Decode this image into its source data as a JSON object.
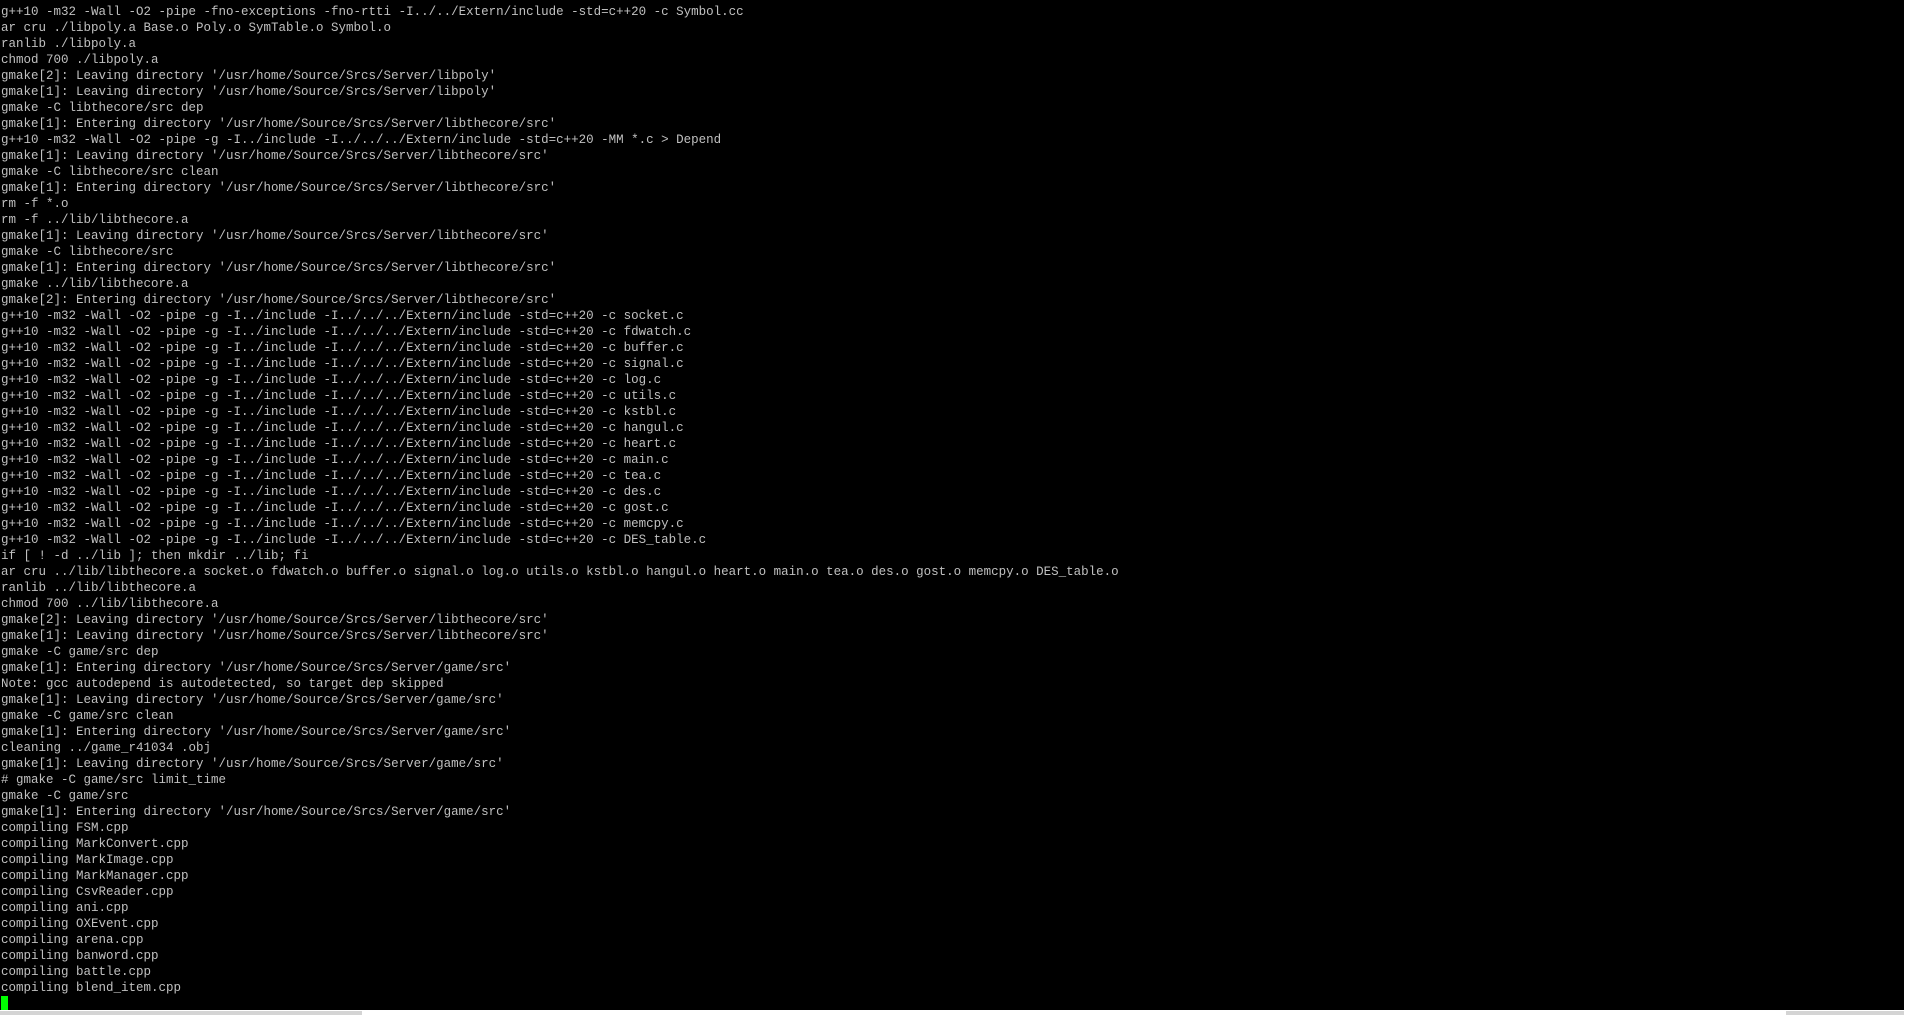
{
  "terminal": {
    "background": "#000000",
    "foreground": "#c0c0c0",
    "cursor_color": "#00ff00",
    "lines": [
      "g++10 -m32 -Wall -O2 -pipe -fno-exceptions -fno-rtti -I../../Extern/include -std=c++20 -c Symbol.cc",
      "ar cru ./libpoly.a Base.o Poly.o SymTable.o Symbol.o",
      "ranlib ./libpoly.a",
      "chmod 700 ./libpoly.a",
      "gmake[2]: Leaving directory '/usr/home/Source/Srcs/Server/libpoly'",
      "gmake[1]: Leaving directory '/usr/home/Source/Srcs/Server/libpoly'",
      "gmake -C libthecore/src dep",
      "gmake[1]: Entering directory '/usr/home/Source/Srcs/Server/libthecore/src'",
      "g++10 -m32 -Wall -O2 -pipe -g -I../include -I../../../Extern/include -std=c++20 -MM *.c > Depend",
      "gmake[1]: Leaving directory '/usr/home/Source/Srcs/Server/libthecore/src'",
      "gmake -C libthecore/src clean",
      "gmake[1]: Entering directory '/usr/home/Source/Srcs/Server/libthecore/src'",
      "rm -f *.o",
      "rm -f ../lib/libthecore.a",
      "gmake[1]: Leaving directory '/usr/home/Source/Srcs/Server/libthecore/src'",
      "gmake -C libthecore/src",
      "gmake[1]: Entering directory '/usr/home/Source/Srcs/Server/libthecore/src'",
      "gmake ../lib/libthecore.a",
      "gmake[2]: Entering directory '/usr/home/Source/Srcs/Server/libthecore/src'",
      "g++10 -m32 -Wall -O2 -pipe -g -I../include -I../../../Extern/include -std=c++20 -c socket.c",
      "g++10 -m32 -Wall -O2 -pipe -g -I../include -I../../../Extern/include -std=c++20 -c fdwatch.c",
      "g++10 -m32 -Wall -O2 -pipe -g -I../include -I../../../Extern/include -std=c++20 -c buffer.c",
      "g++10 -m32 -Wall -O2 -pipe -g -I../include -I../../../Extern/include -std=c++20 -c signal.c",
      "g++10 -m32 -Wall -O2 -pipe -g -I../include -I../../../Extern/include -std=c++20 -c log.c",
      "g++10 -m32 -Wall -O2 -pipe -g -I../include -I../../../Extern/include -std=c++20 -c utils.c",
      "g++10 -m32 -Wall -O2 -pipe -g -I../include -I../../../Extern/include -std=c++20 -c kstbl.c",
      "g++10 -m32 -Wall -O2 -pipe -g -I../include -I../../../Extern/include -std=c++20 -c hangul.c",
      "g++10 -m32 -Wall -O2 -pipe -g -I../include -I../../../Extern/include -std=c++20 -c heart.c",
      "g++10 -m32 -Wall -O2 -pipe -g -I../include -I../../../Extern/include -std=c++20 -c main.c",
      "g++10 -m32 -Wall -O2 -pipe -g -I../include -I../../../Extern/include -std=c++20 -c tea.c",
      "g++10 -m32 -Wall -O2 -pipe -g -I../include -I../../../Extern/include -std=c++20 -c des.c",
      "g++10 -m32 -Wall -O2 -pipe -g -I../include -I../../../Extern/include -std=c++20 -c gost.c",
      "g++10 -m32 -Wall -O2 -pipe -g -I../include -I../../../Extern/include -std=c++20 -c memcpy.c",
      "g++10 -m32 -Wall -O2 -pipe -g -I../include -I../../../Extern/include -std=c++20 -c DES_table.c",
      "if [ ! -d ../lib ]; then mkdir ../lib; fi",
      "ar cru ../lib/libthecore.a socket.o fdwatch.o buffer.o signal.o log.o utils.o kstbl.o hangul.o heart.o main.o tea.o des.o gost.o memcpy.o DES_table.o",
      "ranlib ../lib/libthecore.a",
      "chmod 700 ../lib/libthecore.a",
      "gmake[2]: Leaving directory '/usr/home/Source/Srcs/Server/libthecore/src'",
      "gmake[1]: Leaving directory '/usr/home/Source/Srcs/Server/libthecore/src'",
      "gmake -C game/src dep",
      "gmake[1]: Entering directory '/usr/home/Source/Srcs/Server/game/src'",
      "Note: gcc autodepend is autodetected, so target dep skipped",
      "gmake[1]: Leaving directory '/usr/home/Source/Srcs/Server/game/src'",
      "gmake -C game/src clean",
      "gmake[1]: Entering directory '/usr/home/Source/Srcs/Server/game/src'",
      "cleaning ../game_r41034 .obj",
      "gmake[1]: Leaving directory '/usr/home/Source/Srcs/Server/game/src'",
      "# gmake -C game/src limit_time",
      "gmake -C game/src",
      "gmake[1]: Entering directory '/usr/home/Source/Srcs/Server/game/src'",
      "compiling FSM.cpp",
      "compiling MarkConvert.cpp",
      "compiling MarkImage.cpp",
      "compiling MarkManager.cpp",
      "compiling CsvReader.cpp",
      "compiling ani.cpp",
      "compiling OXEvent.cpp",
      "compiling arena.cpp",
      "compiling banword.cpp",
      "compiling battle.cpp",
      "compiling blend_item.cpp"
    ]
  }
}
